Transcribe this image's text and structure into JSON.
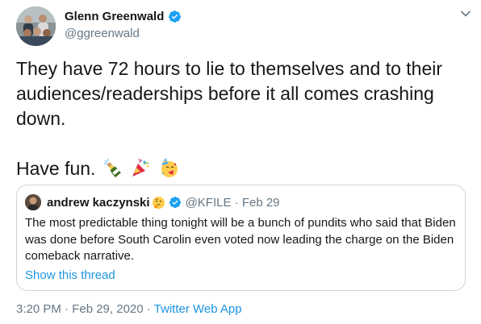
{
  "author": {
    "display_name": "Glenn Greenwald",
    "handle": "@ggreenwald",
    "verified": true
  },
  "tweet": {
    "lines": [
      "They have 72 hours to lie to themselves and to their",
      "audiences/readerships before it all comes crashing",
      "down."
    ],
    "closing": "Have fun.",
    "emojis": [
      "bottle-with-popping-cork-icon",
      "party-popper-icon",
      "partying-face-icon"
    ]
  },
  "quote": {
    "display_name": "andrew kaczynski",
    "name_emoji": "thinking-face-icon",
    "verified": true,
    "handle_date": "@KFILE · Feb 29",
    "lines": [
      "The most predictable thing tonight will be a bunch of pundits who said that Biden",
      "was done before South Carolin even voted now leading the charge on the Biden",
      "comeback narrative."
    ],
    "show_thread": "Show this thread"
  },
  "meta": {
    "timestamp": "3:20 PM · Feb 29, 2020 · ",
    "source": "Twitter Web App"
  },
  "colors": {
    "text": "#14171a",
    "secondary": "#657786",
    "link": "#1b95e0",
    "verified": "#1da1f2",
    "border": "#ccd6dd"
  }
}
